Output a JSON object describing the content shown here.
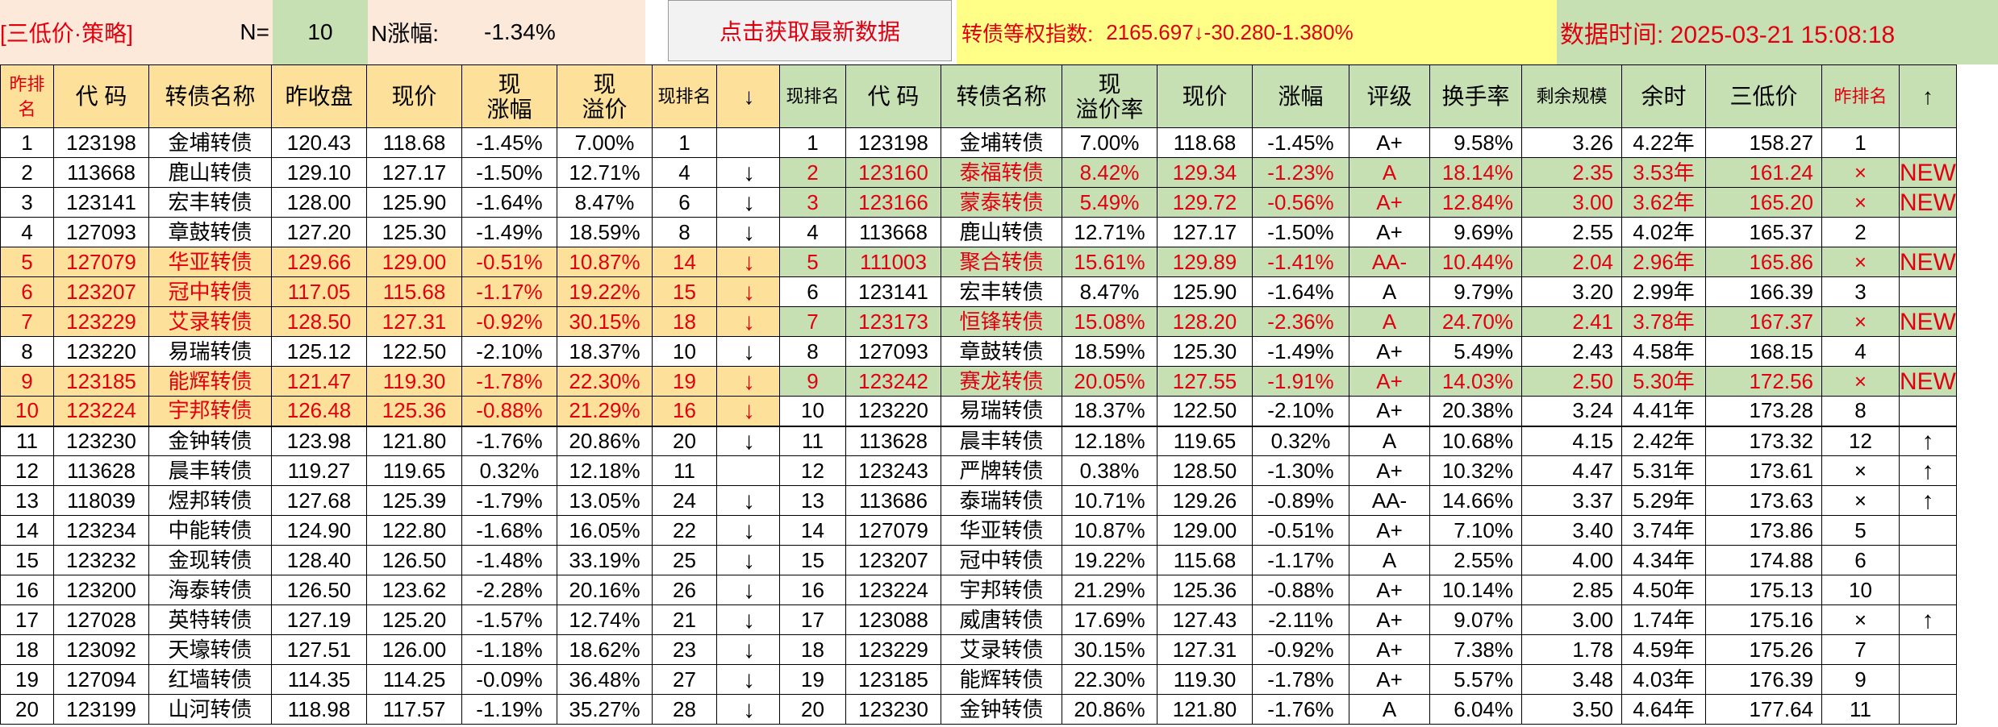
{
  "header": {
    "strategy_label": "[三低价·策略]",
    "n_label": "N=",
    "n_value": "10",
    "n_change_label": "N涨幅:",
    "n_change_value": "-1.34%",
    "refresh_button": "点击获取最新数据",
    "index_label": "转债等权指数:",
    "index_value": "2165.697↓-30.280-1.380%",
    "time_label": "数据时间: 2025-03-21 15:08:18"
  },
  "colors": {
    "accent_red": "#e0000f",
    "yellow_fill": "#fde19a",
    "green_fill": "#c6e0b4",
    "index_bg": "#ffff88"
  },
  "left_table": {
    "columns": [
      "昨排名",
      "代 码",
      "转债名称",
      "昨收盘",
      "现价",
      "现\n涨幅",
      "现\n溢价",
      "现排名",
      "↓"
    ],
    "rows": [
      {
        "c": [
          "1",
          "123198",
          "金埔转债",
          "120.43",
          "118.68",
          "-1.45%",
          "7.00%",
          "1",
          ""
        ],
        "hl": false
      },
      {
        "c": [
          "2",
          "113668",
          "鹿山转债",
          "129.10",
          "127.17",
          "-1.50%",
          "12.71%",
          "4",
          "↓"
        ],
        "hl": false
      },
      {
        "c": [
          "3",
          "123141",
          "宏丰转债",
          "128.00",
          "125.90",
          "-1.64%",
          "8.47%",
          "6",
          "↓"
        ],
        "hl": false
      },
      {
        "c": [
          "4",
          "127093",
          "章鼓转债",
          "127.20",
          "125.30",
          "-1.49%",
          "18.59%",
          "8",
          "↓"
        ],
        "hl": false
      },
      {
        "c": [
          "5",
          "127079",
          "华亚转债",
          "129.66",
          "129.00",
          "-0.51%",
          "10.87%",
          "14",
          "↓"
        ],
        "hl": true
      },
      {
        "c": [
          "6",
          "123207",
          "冠中转债",
          "117.05",
          "115.68",
          "-1.17%",
          "19.22%",
          "15",
          "↓"
        ],
        "hl": true
      },
      {
        "c": [
          "7",
          "123229",
          "艾录转债",
          "128.50",
          "127.31",
          "-0.92%",
          "30.15%",
          "18",
          "↓"
        ],
        "hl": true
      },
      {
        "c": [
          "8",
          "123220",
          "易瑞转债",
          "125.12",
          "122.50",
          "-2.10%",
          "18.37%",
          "10",
          "↓"
        ],
        "hl": false
      },
      {
        "c": [
          "9",
          "123185",
          "能辉转债",
          "121.47",
          "119.30",
          "-1.78%",
          "22.30%",
          "19",
          "↓"
        ],
        "hl": true
      },
      {
        "c": [
          "10",
          "123224",
          "宇邦转债",
          "126.48",
          "125.36",
          "-0.88%",
          "21.29%",
          "16",
          "↓"
        ],
        "hl": true
      },
      {
        "c": [
          "11",
          "123230",
          "金钟转债",
          "123.98",
          "121.80",
          "-1.76%",
          "20.86%",
          "20",
          "↓"
        ],
        "hl": false
      },
      {
        "c": [
          "12",
          "113628",
          "晨丰转债",
          "119.27",
          "119.65",
          "0.32%",
          "12.18%",
          "11",
          ""
        ],
        "hl": false
      },
      {
        "c": [
          "13",
          "118039",
          "煜邦转债",
          "127.68",
          "125.39",
          "-1.79%",
          "13.05%",
          "24",
          "↓"
        ],
        "hl": false
      },
      {
        "c": [
          "14",
          "123234",
          "中能转债",
          "124.90",
          "122.80",
          "-1.68%",
          "16.05%",
          "22",
          "↓"
        ],
        "hl": false
      },
      {
        "c": [
          "15",
          "123232",
          "金现转债",
          "128.40",
          "126.50",
          "-1.48%",
          "33.19%",
          "25",
          "↓"
        ],
        "hl": false
      },
      {
        "c": [
          "16",
          "123200",
          "海泰转债",
          "126.50",
          "123.62",
          "-2.28%",
          "20.16%",
          "26",
          "↓"
        ],
        "hl": false
      },
      {
        "c": [
          "17",
          "127028",
          "英特转债",
          "127.19",
          "125.20",
          "-1.57%",
          "12.74%",
          "21",
          "↓"
        ],
        "hl": false
      },
      {
        "c": [
          "18",
          "123092",
          "天壕转债",
          "127.51",
          "126.00",
          "-1.18%",
          "18.62%",
          "23",
          "↓"
        ],
        "hl": false
      },
      {
        "c": [
          "19",
          "127094",
          "红墙转债",
          "114.35",
          "114.25",
          "-0.09%",
          "36.48%",
          "27",
          "↓"
        ],
        "hl": false
      },
      {
        "c": [
          "20",
          "123199",
          "山河转债",
          "118.98",
          "117.57",
          "-1.19%",
          "35.27%",
          "28",
          "↓"
        ],
        "hl": false
      }
    ]
  },
  "right_table": {
    "columns": [
      "现排名",
      "代 码",
      "转债名称",
      "现\n溢价率",
      "现价",
      "涨幅",
      "评级",
      "换手率",
      "剩余规模",
      "余时",
      "三低价",
      "昨排名",
      "↑"
    ],
    "rows": [
      {
        "c": [
          "1",
          "123198",
          "金埔转债",
          "7.00%",
          "118.68",
          "-1.45%",
          "A+",
          "9.58%",
          "3.26",
          "4.22年",
          "158.27",
          "1",
          ""
        ],
        "hl": false
      },
      {
        "c": [
          "2",
          "123160",
          "泰福转债",
          "8.42%",
          "129.34",
          "-1.23%",
          "A",
          "18.14%",
          "2.35",
          "3.53年",
          "161.24",
          "×",
          "NEW"
        ],
        "hl": true
      },
      {
        "c": [
          "3",
          "123166",
          "蒙泰转债",
          "5.49%",
          "129.72",
          "-0.56%",
          "A+",
          "12.84%",
          "3.00",
          "3.62年",
          "165.20",
          "×",
          "NEW"
        ],
        "hl": true
      },
      {
        "c": [
          "4",
          "113668",
          "鹿山转债",
          "12.71%",
          "127.17",
          "-1.50%",
          "A+",
          "9.69%",
          "2.55",
          "4.02年",
          "165.37",
          "2",
          ""
        ],
        "hl": false
      },
      {
        "c": [
          "5",
          "111003",
          "聚合转债",
          "15.61%",
          "129.89",
          "-1.41%",
          "AA-",
          "10.44%",
          "2.04",
          "2.96年",
          "165.86",
          "×",
          "NEW"
        ],
        "hl": true
      },
      {
        "c": [
          "6",
          "123141",
          "宏丰转债",
          "8.47%",
          "125.90",
          "-1.64%",
          "A",
          "9.79%",
          "3.20",
          "2.99年",
          "166.39",
          "3",
          ""
        ],
        "hl": false
      },
      {
        "c": [
          "7",
          "123173",
          "恒锋转债",
          "15.08%",
          "128.20",
          "-2.36%",
          "A",
          "24.70%",
          "2.41",
          "3.78年",
          "167.37",
          "×",
          "NEW"
        ],
        "hl": true
      },
      {
        "c": [
          "8",
          "127093",
          "章鼓转债",
          "18.59%",
          "125.30",
          "-1.49%",
          "A+",
          "5.49%",
          "2.43",
          "4.58年",
          "168.15",
          "4",
          ""
        ],
        "hl": false
      },
      {
        "c": [
          "9",
          "123242",
          "赛龙转债",
          "20.05%",
          "127.55",
          "-1.91%",
          "A+",
          "14.03%",
          "2.50",
          "5.30年",
          "172.56",
          "×",
          "NEW"
        ],
        "hl": true
      },
      {
        "c": [
          "10",
          "123220",
          "易瑞转债",
          "18.37%",
          "122.50",
          "-2.10%",
          "A+",
          "20.38%",
          "3.24",
          "4.41年",
          "173.28",
          "8",
          ""
        ],
        "hl": false
      },
      {
        "c": [
          "11",
          "113628",
          "晨丰转债",
          "12.18%",
          "119.65",
          "0.32%",
          "A",
          "10.68%",
          "4.15",
          "2.42年",
          "173.32",
          "12",
          "↑"
        ],
        "hl": false
      },
      {
        "c": [
          "12",
          "123243",
          "严牌转债",
          "0.38%",
          "128.50",
          "-1.30%",
          "A+",
          "10.32%",
          "4.47",
          "5.31年",
          "173.61",
          "×",
          "↑"
        ],
        "hl": false
      },
      {
        "c": [
          "13",
          "113686",
          "泰瑞转债",
          "10.71%",
          "129.26",
          "-0.89%",
          "AA-",
          "14.66%",
          "3.37",
          "5.29年",
          "173.63",
          "×",
          "↑"
        ],
        "hl": false
      },
      {
        "c": [
          "14",
          "127079",
          "华亚转债",
          "10.87%",
          "129.00",
          "-0.51%",
          "A+",
          "7.10%",
          "3.40",
          "3.74年",
          "173.86",
          "5",
          ""
        ],
        "hl": false
      },
      {
        "c": [
          "15",
          "123207",
          "冠中转债",
          "19.22%",
          "115.68",
          "-1.17%",
          "A",
          "2.55%",
          "4.00",
          "4.34年",
          "174.88",
          "6",
          ""
        ],
        "hl": false
      },
      {
        "c": [
          "16",
          "123224",
          "宇邦转债",
          "21.29%",
          "125.36",
          "-0.88%",
          "A+",
          "10.14%",
          "2.85",
          "4.50年",
          "175.13",
          "10",
          ""
        ],
        "hl": false
      },
      {
        "c": [
          "17",
          "123088",
          "威唐转债",
          "17.69%",
          "127.43",
          "-2.11%",
          "A+",
          "9.07%",
          "3.00",
          "1.74年",
          "175.16",
          "×",
          "↑"
        ],
        "hl": false
      },
      {
        "c": [
          "18",
          "123229",
          "艾录转债",
          "30.15%",
          "127.31",
          "-0.92%",
          "A+",
          "7.38%",
          "1.78",
          "4.59年",
          "175.26",
          "7",
          ""
        ],
        "hl": false
      },
      {
        "c": [
          "19",
          "123185",
          "能辉转债",
          "22.30%",
          "119.30",
          "-1.78%",
          "A+",
          "5.57%",
          "3.48",
          "4.03年",
          "176.39",
          "9",
          ""
        ],
        "hl": false
      },
      {
        "c": [
          "20",
          "123230",
          "金钟转债",
          "20.86%",
          "121.80",
          "-1.76%",
          "A",
          "6.04%",
          "3.50",
          "4.64年",
          "177.64",
          "11",
          ""
        ],
        "hl": false
      }
    ]
  }
}
